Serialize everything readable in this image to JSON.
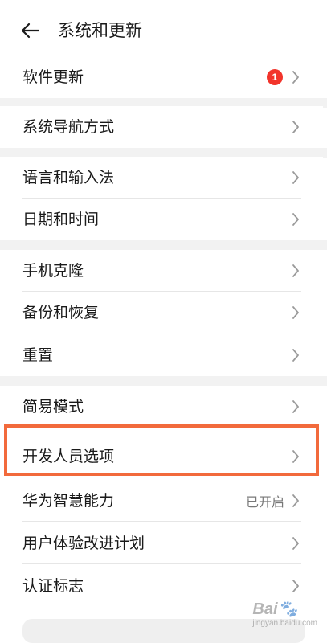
{
  "header": {
    "title": "系统和更新",
    "back_icon": "arrow-left-icon"
  },
  "rows": [
    {
      "label": "软件更新",
      "badge": "1"
    },
    {
      "label": "系统导航方式"
    },
    {
      "label": "语言和输入法"
    },
    {
      "label": "日期和时间"
    },
    {
      "label": "手机克隆"
    },
    {
      "label": "备份和恢复"
    },
    {
      "label": "重置"
    },
    {
      "label": "简易模式"
    },
    {
      "label": "开发人员选项"
    },
    {
      "label": "华为智慧能力",
      "status": "已开启"
    },
    {
      "label": "用户体验改进计划"
    },
    {
      "label": "认证标志"
    }
  ],
  "colors": {
    "badge": "#f2342b",
    "highlight": "#f26a3c",
    "section_gap": "#f2f2f2"
  },
  "watermark": {
    "text": "Bai",
    "sub": "jingyan.baidu.com"
  }
}
